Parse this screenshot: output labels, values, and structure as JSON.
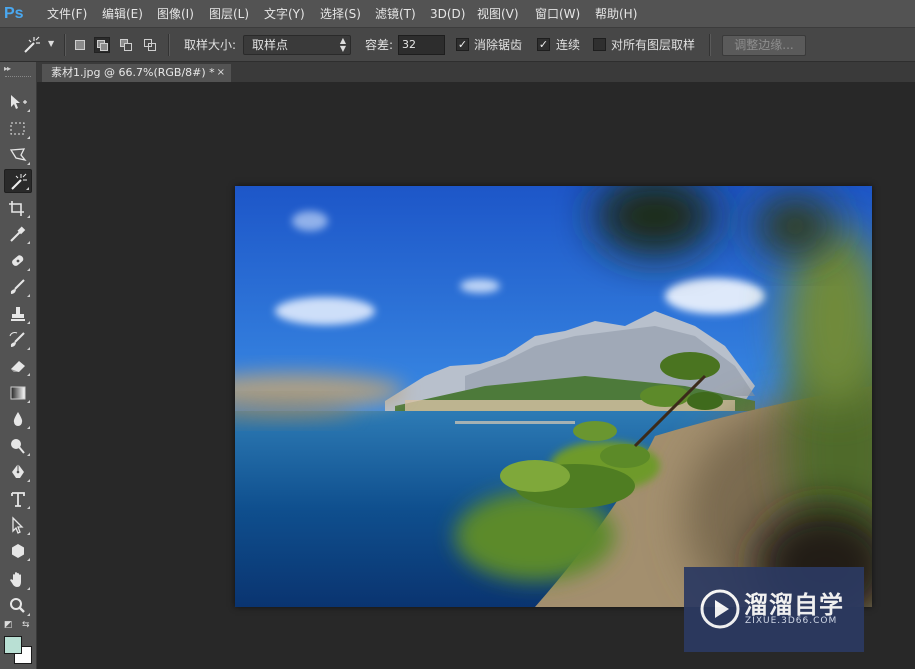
{
  "app": {
    "logo": "Ps"
  },
  "menu": [
    "文件(F)",
    "编辑(E)",
    "图像(I)",
    "图层(L)",
    "文字(Y)",
    "选择(S)",
    "滤镜(T)",
    "3D(D)",
    "视图(V)",
    "窗口(W)",
    "帮助(H)"
  ],
  "options": {
    "tool_icon": "magic-wand-icon",
    "selection_modes": [
      "new-selection",
      "add-to-selection",
      "subtract-from-selection",
      "intersect-with-selection"
    ],
    "active_mode": "add-to-selection",
    "sample_size_label": "取样大小:",
    "sample_size_value": "取样点",
    "tolerance_label": "容差:",
    "tolerance_value": "32",
    "antialias_label": "消除锯齿",
    "antialias_checked": true,
    "contiguous_label": "连续",
    "contiguous_checked": true,
    "sample_all_layers_label": "对所有图层取样",
    "sample_all_layers_checked": false,
    "refine_edge_label": "调整边缘..."
  },
  "document": {
    "tab_title": "素材1.jpg @ 66.7%(RGB/8#) *",
    "close_glyph": "×"
  },
  "tools": [
    "move-tool",
    "rectangular-marquee-tool",
    "polygonal-lasso-tool",
    "magic-wand-tool",
    "crop-tool",
    "eyedropper-tool",
    "spot-healing-brush-tool",
    "brush-tool",
    "clone-stamp-tool",
    "history-brush-tool",
    "eraser-tool",
    "gradient-tool",
    "blur-tool",
    "dodge-tool",
    "pen-tool",
    "type-tool",
    "path-selection-tool",
    "shape-tool",
    "hand-tool",
    "zoom-tool"
  ],
  "active_tool": "magic-wand-tool",
  "colors": {
    "foreground": "#b9e0d4",
    "background": "#ffffff",
    "accent": "#4aa8f0"
  },
  "watermark": {
    "title": "溜溜自学",
    "url": "ZIXUE.3D66.COM"
  }
}
